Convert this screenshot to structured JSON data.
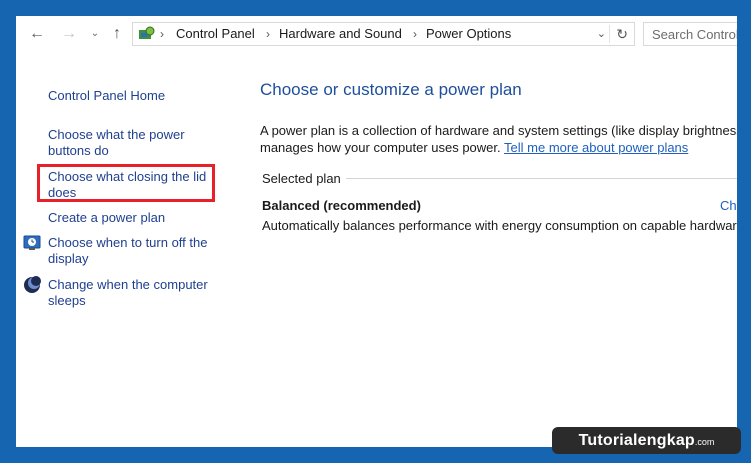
{
  "address_bar": {
    "crumbs": [
      "Control Panel",
      "Hardware and Sound",
      "Power Options"
    ]
  },
  "search": {
    "placeholder": "Search Control Panel"
  },
  "left_pane": {
    "home": "Control Panel Home",
    "links": {
      "power_buttons": [
        "Choose what the power",
        "buttons do"
      ],
      "closing_lid": [
        "Choose what closing the lid",
        "does"
      ],
      "create_plan": "Create a power plan",
      "display_off": [
        "Choose when to turn off the",
        "display"
      ],
      "computer_sleeps": [
        "Change when the computer",
        "sleeps"
      ]
    },
    "highlight_color": "#e8202a"
  },
  "main": {
    "title": "Choose or customize a power plan",
    "description_line1": "A power plan is a collection of hardware and system settings (like display brightness, sleep, etc.) that",
    "description_line2": "manages how your computer uses power.",
    "learn_more": "Tell me more about power plans",
    "selected_plan_label": "Selected plan",
    "plan": {
      "name": "Balanced (recommended)",
      "change_link": "Change plan settings",
      "description": "Automatically balances performance with energy consumption on capable hardware."
    }
  },
  "watermark": {
    "name": "Tutorialengkap",
    "tld": ".com"
  },
  "colors": {
    "frame": "#1565b0",
    "link": "#1f3f8f",
    "title": "#1e4e9c"
  }
}
